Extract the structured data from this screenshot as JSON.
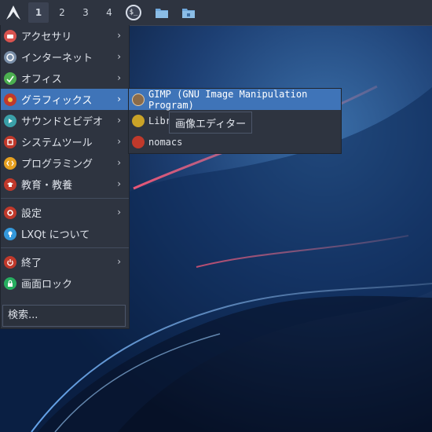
{
  "panel": {
    "workspaces": [
      "1",
      "2",
      "3",
      "4"
    ],
    "terminal_label": "$_"
  },
  "menu": {
    "items": [
      {
        "label": "アクセサリ",
        "icon": "accessories-icon",
        "color": "#d9534f"
      },
      {
        "label": "インターネット",
        "icon": "internet-icon",
        "color": "#7a8fa8"
      },
      {
        "label": "オフィス",
        "icon": "office-icon",
        "color": "#4caf50"
      },
      {
        "label": "グラフィックス",
        "icon": "graphics-icon",
        "color": "#c0392b"
      },
      {
        "label": "サウンドとビデオ",
        "icon": "sound-video-icon",
        "color": "#3aa0a8"
      },
      {
        "label": "システムツール",
        "icon": "system-tools-icon",
        "color": "#c0392b"
      },
      {
        "label": "プログラミング",
        "icon": "programming-icon",
        "color": "#e6a020"
      },
      {
        "label": "教育・教養",
        "icon": "education-icon",
        "color": "#c0392b"
      },
      {
        "label": "設定",
        "icon": "settings-icon",
        "color": "#c0392b"
      },
      {
        "label": "LXQt について",
        "icon": "about-icon",
        "color": "#3498db"
      },
      {
        "label": "終了",
        "icon": "power-icon",
        "color": "#c0392b"
      },
      {
        "label": "画面ロック",
        "icon": "lock-icon",
        "color": "#27ae60"
      }
    ],
    "search_placeholder": "検索..."
  },
  "submenu": {
    "items": [
      {
        "label": "GIMP (GNU Image Manipulation Program)",
        "icon": "gimp-icon",
        "color": "#8a6b4a"
      },
      {
        "label": "Libr",
        "icon": "libreoffice-draw-icon",
        "color": "#c9a227"
      },
      {
        "label": "nomacs",
        "icon": "nomacs-icon",
        "color": "#c0392b"
      }
    ]
  },
  "tooltip": {
    "text": "画像エディター"
  }
}
